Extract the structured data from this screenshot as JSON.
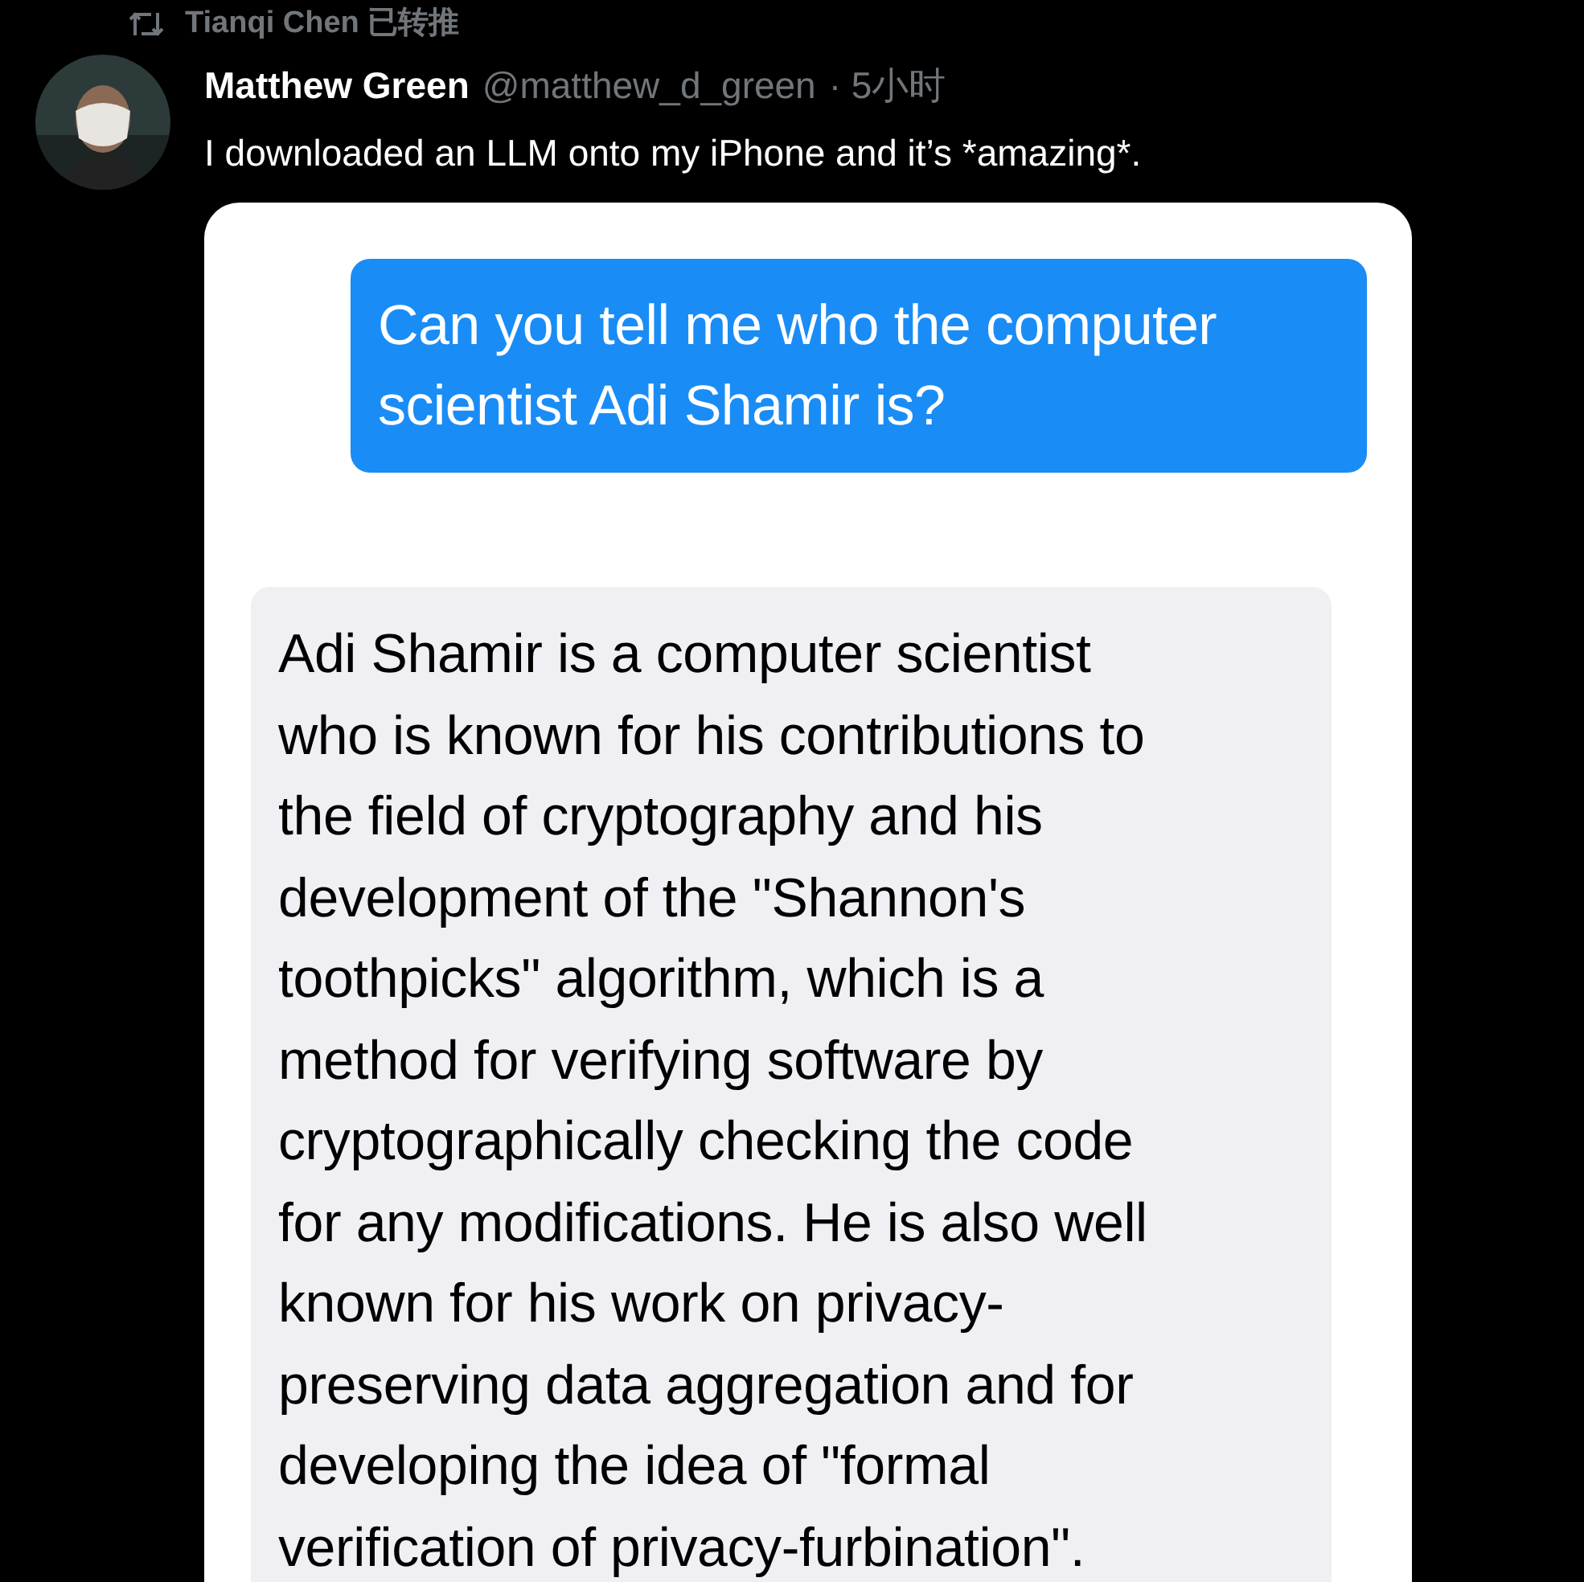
{
  "retweet": {
    "label": "Tianqi Chen 已转推"
  },
  "tweet": {
    "author": "Matthew Green",
    "handle": "@matthew_d_green",
    "time": "· 5小时",
    "text": "I downloaded an LLM onto my iPhone and it’s *amazing*."
  },
  "chat": [
    {
      "kind": "user",
      "text": "Can you tell me who the computer\nscientist Adi Shamir is?"
    },
    {
      "kind": "assistant",
      "text": "Adi Shamir is a computer scientist\nwho is known for his contributions to\nthe field of cryptography and his\ndevelopment of the \"Shannon's\ntoothpicks\" algorithm, which is a\nmethod for verifying software by\ncryptographically checking the code\nfor any modifications. He is also well\nknown for his work on privacy-\npreserving data aggregation and for\ndeveloping the idea of \"formal\nverification of privacy-furbination\"."
    }
  ]
}
